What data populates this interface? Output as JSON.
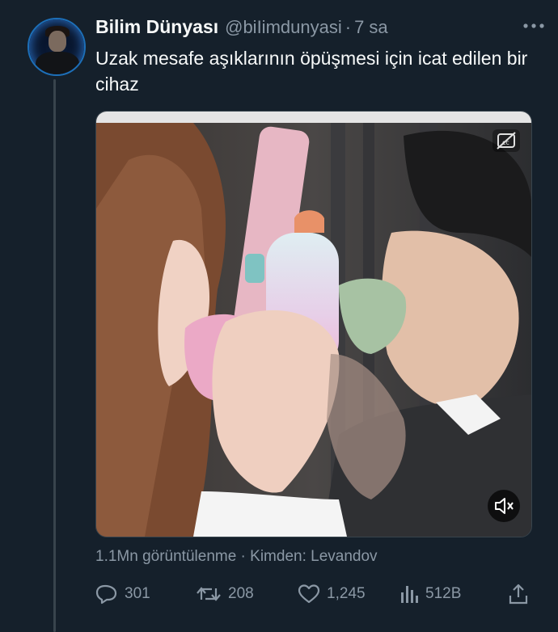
{
  "tweet": {
    "display_name": "Bilim Dünyası",
    "handle": "@biIimdunyasi",
    "separator": "·",
    "time": "7 sa",
    "text": "Uzak mesafe aşıklarının öpüşmesi için icat edilen bir cihaz",
    "views_line": "1.1Mn görüntülenme · Kimden: Levandov"
  },
  "actions": {
    "replies": "301",
    "retweets": "208",
    "likes": "1,245",
    "views": "512B"
  },
  "icons": {
    "more": "more-horizontal-icon",
    "cc": "closed-captions-off-icon",
    "mute": "volume-muted-icon",
    "reply": "reply-icon",
    "retweet": "retweet-icon",
    "like": "heart-icon",
    "analytics": "bar-chart-icon",
    "share": "share-icon"
  },
  "colors": {
    "background": "#15202b",
    "text": "#f7f9f9",
    "muted": "#8b98a5"
  }
}
